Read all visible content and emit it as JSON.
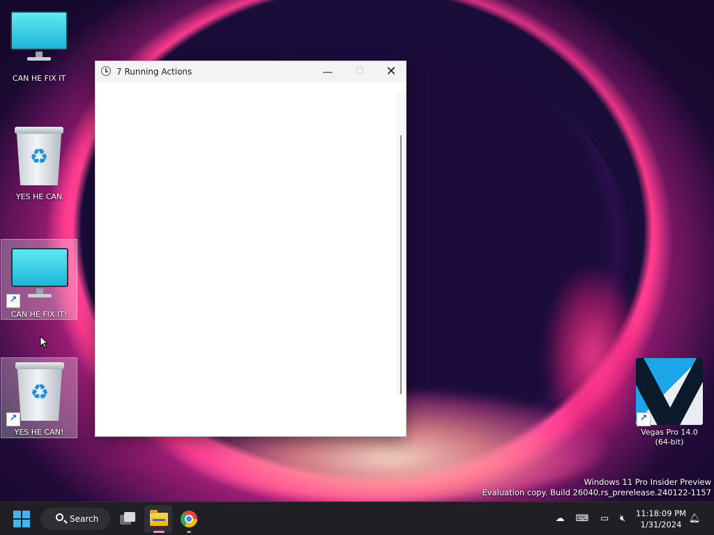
{
  "desktop": {
    "icons": [
      {
        "label": "CAN HE FIX IT",
        "type": "this-pc"
      },
      {
        "label": "YES HE CAN",
        "type": "recycle-bin"
      },
      {
        "label": "CAN HE FIX IT!",
        "type": "this-pc-shortcut"
      },
      {
        "label": "YES HE CAN!",
        "type": "recycle-bin-shortcut"
      }
    ],
    "vegas": {
      "line1": "Vegas Pro 14.0",
      "line2": "(64-bit)"
    },
    "watermark": {
      "line1": "Windows 11 Pro Insider Preview",
      "line2": "Evaluation copy. Build 26040.rs_prerelease.240122-1157"
    }
  },
  "window": {
    "title": "7 Running Actions",
    "minimize": "—",
    "maximize": "☐",
    "close": "✕"
  },
  "taskbar": {
    "search_label": "Search",
    "time": "11:18:09 PM",
    "date": "1/31/2024"
  },
  "colors": {
    "accent": "#3fb6f2",
    "taskbar": "#1f1f24"
  }
}
